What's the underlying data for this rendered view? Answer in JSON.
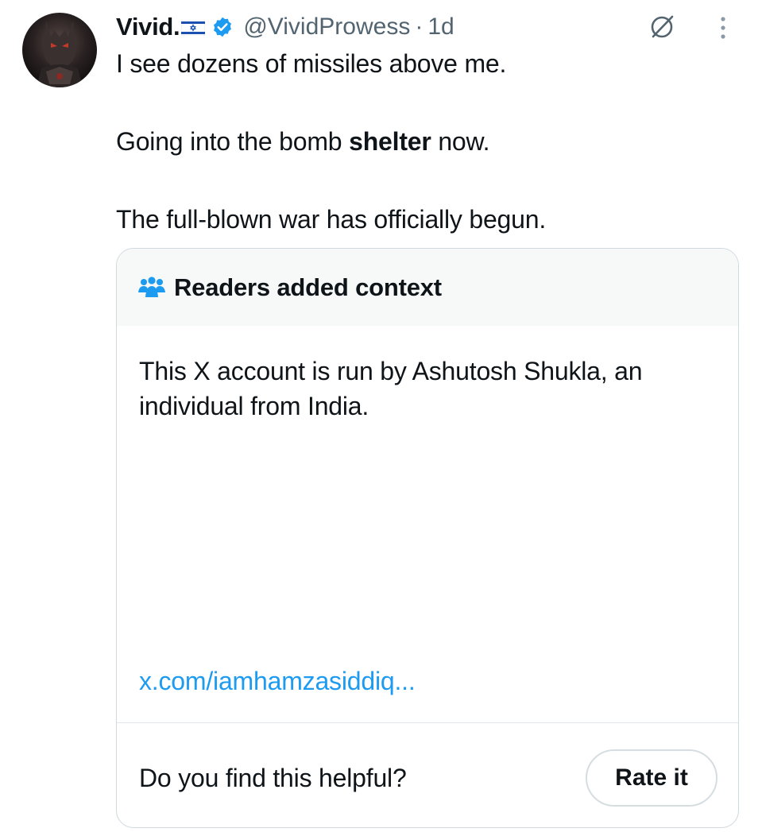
{
  "author": {
    "display_name": "Vivid.",
    "handle": "@VividProwess",
    "separator": "·",
    "time": "1d",
    "flag_icon": "israel-flag-icon",
    "verified_icon": "verified-badge-icon"
  },
  "tweet": {
    "line1": "I see dozens of missiles above me.",
    "line2_before": "Going into the bomb ",
    "line2_bold": "shelter",
    "line2_after": " now.",
    "line3": "The full-blown war has officially begun."
  },
  "community_note": {
    "title": "Readers added context",
    "icon": "readers-group-icon",
    "text": "This X account is run by Ashutosh Shukla, an individual from India.",
    "link": "x.com/iamhamzasiddiq...",
    "helpful_question": "Do you find this helpful?",
    "rate_button": "Rate it"
  },
  "colors": {
    "verified_blue": "#1d9bf0",
    "link_blue": "#1d9bf0",
    "muted_text": "#536471",
    "note_header_bg": "#f7f9f9"
  }
}
